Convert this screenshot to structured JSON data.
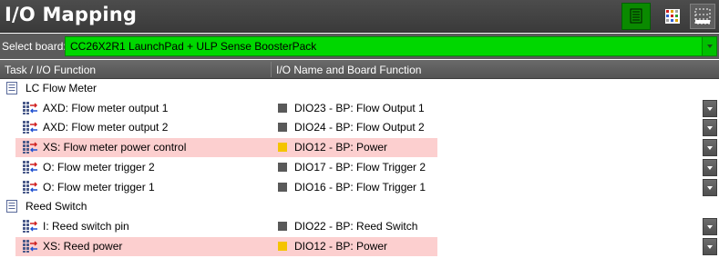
{
  "window": {
    "title": "I/O Mapping"
  },
  "toolbar": {
    "buttons": [
      {
        "icon": "list-view-icon",
        "active": true
      },
      {
        "icon": "color-grid-icon",
        "active": false
      },
      {
        "icon": "dotted-grid-icon",
        "active": false
      }
    ]
  },
  "board": {
    "label": "Select board:",
    "value": "CC26X2R1 LaunchPad + ULP Sense BoosterPack"
  },
  "table": {
    "columns": [
      "Task / I/O Function",
      "I/O Name and Board Function"
    ],
    "groups": [
      {
        "name": "LC Flow Meter",
        "items": [
          {
            "function": "AXD: Flow meter output 1",
            "pin": "DIO23 - BP: Flow Output 1",
            "conflict": false
          },
          {
            "function": "AXD: Flow meter output 2",
            "pin": "DIO24 - BP: Flow Output 2",
            "conflict": false
          },
          {
            "function": "XS: Flow meter power control",
            "pin": "DIO12 - BP: Power",
            "conflict": true
          },
          {
            "function": "O: Flow meter trigger 2",
            "pin": "DIO17 - BP: Flow Trigger 2",
            "conflict": false
          },
          {
            "function": "O: Flow meter trigger 1",
            "pin": "DIO16 - BP: Flow Trigger 1",
            "conflict": false
          }
        ]
      },
      {
        "name": "Reed Switch",
        "items": [
          {
            "function": "I: Reed switch pin",
            "pin": "DIO22 - BP: Reed Switch",
            "conflict": false
          },
          {
            "function": "XS: Reed power",
            "pin": "DIO12 - BP: Power",
            "conflict": true
          }
        ]
      }
    ]
  },
  "colors": {
    "board_select_bg": "#00d700",
    "conflict_row_bg": "#fccfcf",
    "pin_used": "#f4c400",
    "pin_normal": "#595959"
  }
}
